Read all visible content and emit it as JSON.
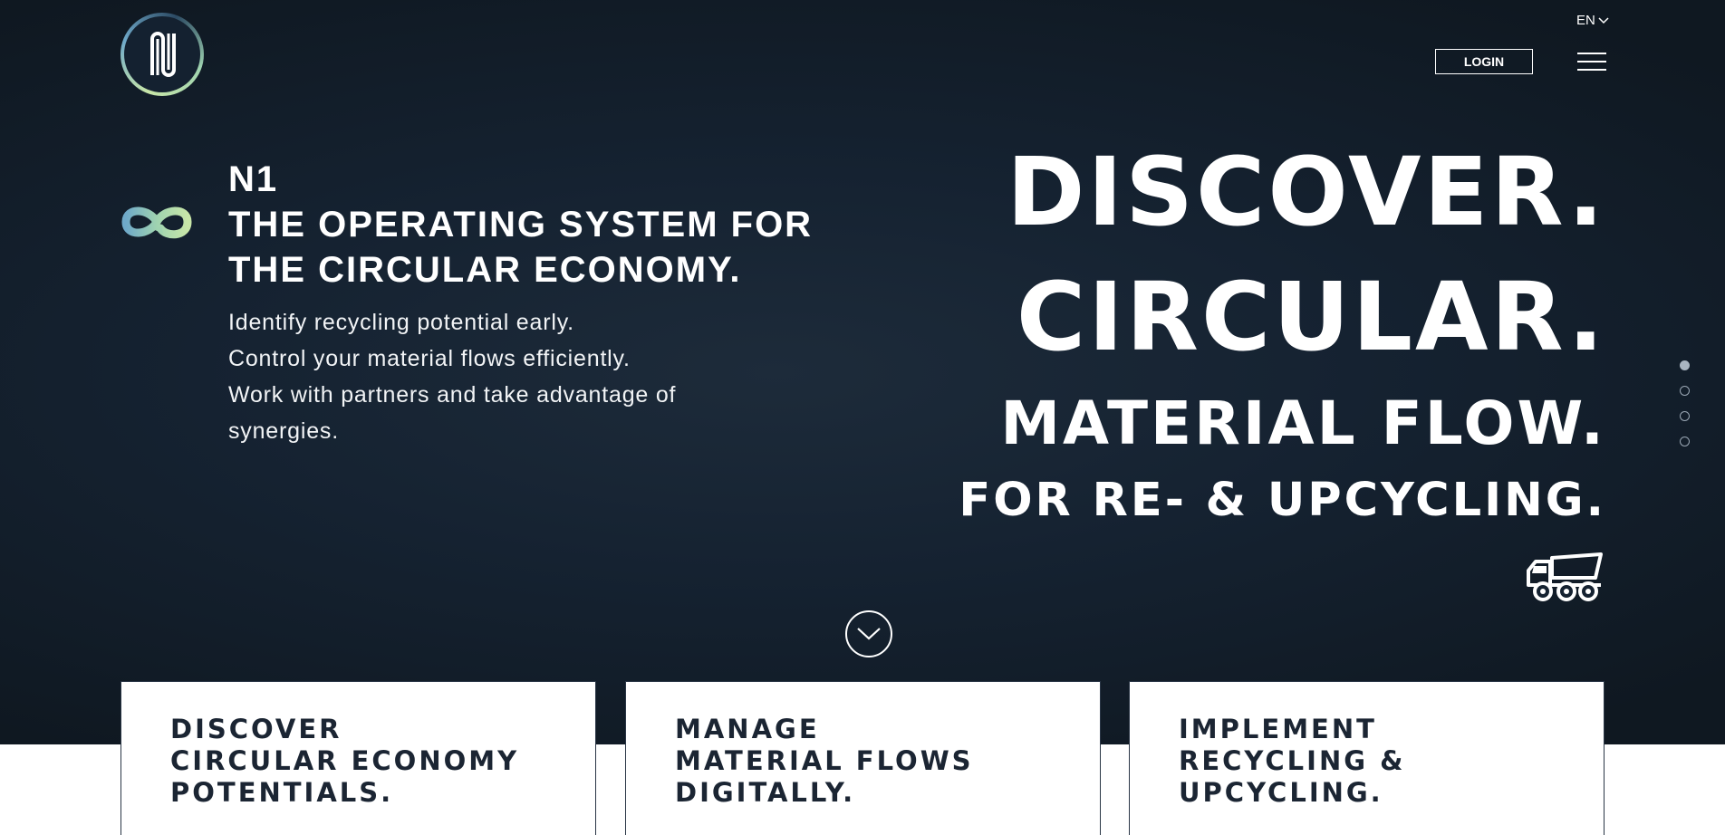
{
  "header": {
    "logo_alt": "N1 logo",
    "language": "EN",
    "login_label": "LOGIN"
  },
  "intro": {
    "title_line1": "N1",
    "title_line2": "THE OPERATING SYSTEM FOR",
    "title_line3": "THE CIRCULAR ECONOMY.",
    "lines": [
      "Identify recycling potential early.",
      "Control your material flows efficiently.",
      "Work with partners and take advantage of",
      "synergies."
    ]
  },
  "headline": {
    "line1": "DISCOVER.",
    "line2": "CIRCULAR.",
    "line3": "MATERIAL FLOW.",
    "line4": "FOR RE- & UPCYCLING."
  },
  "slider": {
    "count": 4,
    "active": 1
  },
  "cards": [
    {
      "lines": [
        "DISCOVER",
        "CIRCULAR ECONOMY",
        "POTENTIALS."
      ]
    },
    {
      "lines": [
        "MANAGE",
        "MATERIAL FLOWS",
        "DIGITALLY."
      ]
    },
    {
      "lines": [
        "IMPLEMENT",
        "RECYCLING &",
        "UPCYCLING."
      ]
    }
  ],
  "colors": {
    "hero_bg": "#152231",
    "card_text": "#1b2533",
    "infinity_gradient": [
      "#c8e6a8",
      "#6fa9c9"
    ]
  },
  "icons": [
    "n1-logo-icon",
    "chevron-down-icon",
    "hamburger-menu-icon",
    "infinity-icon",
    "dump-truck-icon",
    "scroll-down-icon"
  ]
}
